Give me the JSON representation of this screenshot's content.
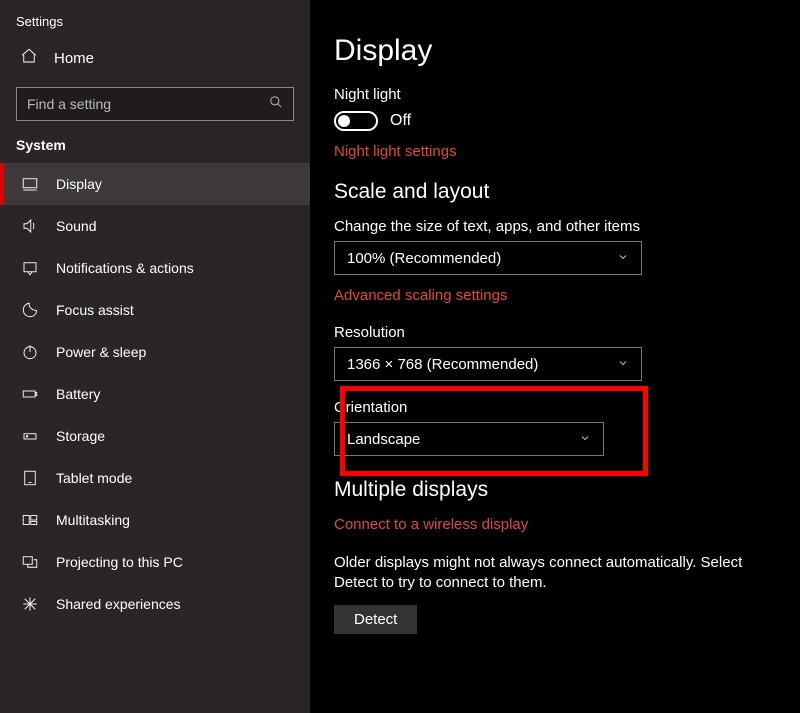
{
  "app": {
    "title": "Settings"
  },
  "sidebar": {
    "home": "Home",
    "search_placeholder": "Find a setting",
    "section": "System",
    "items": [
      {
        "label": "Display"
      },
      {
        "label": "Sound"
      },
      {
        "label": "Notifications & actions"
      },
      {
        "label": "Focus assist"
      },
      {
        "label": "Power & sleep"
      },
      {
        "label": "Battery"
      },
      {
        "label": "Storage"
      },
      {
        "label": "Tablet mode"
      },
      {
        "label": "Multitasking"
      },
      {
        "label": "Projecting to this PC"
      },
      {
        "label": "Shared experiences"
      }
    ]
  },
  "page": {
    "title": "Display",
    "night_light_label": "Night light",
    "night_light_state": "Off",
    "night_light_link": "Night light settings",
    "scale_header": "Scale and layout",
    "scale_text_label": "Change the size of text, apps, and other items",
    "scale_value": "100% (Recommended)",
    "advanced_scaling_link": "Advanced scaling settings",
    "resolution_label": "Resolution",
    "resolution_value": "1366 × 768 (Recommended)",
    "orientation_label": "Orientation",
    "orientation_value": "Landscape",
    "multiple_header": "Multiple displays",
    "connect_link": "Connect to a wireless display",
    "older_text": "Older displays might not always connect automatically. Select Detect to try to connect to them.",
    "detect_btn": "Detect"
  }
}
